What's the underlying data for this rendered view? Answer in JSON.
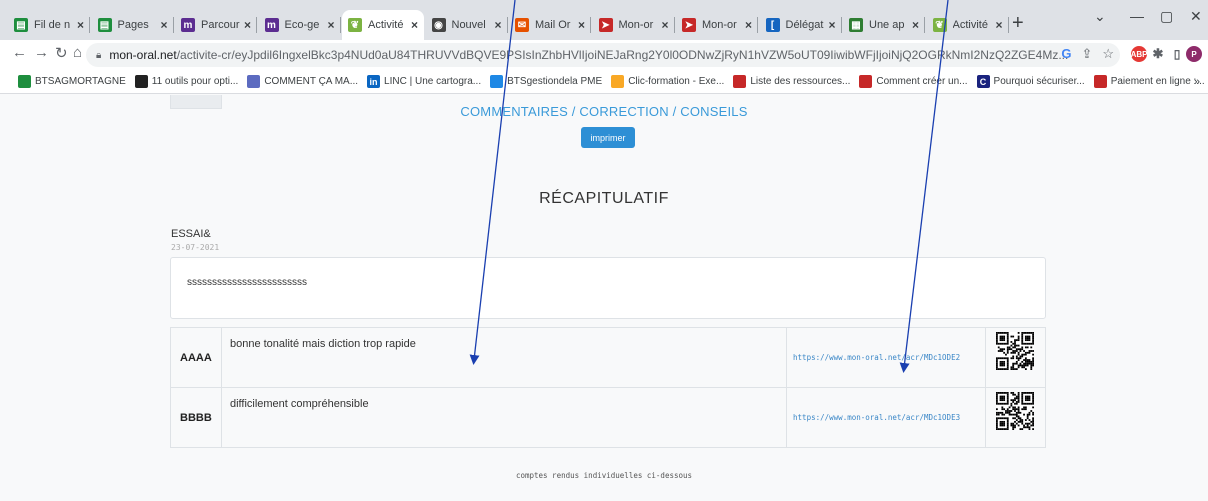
{
  "browser": {
    "tabs": [
      {
        "label": "Fil de n",
        "icon": "classroom-icon",
        "color": "#1e8e3e",
        "glyph": "▤"
      },
      {
        "label": "Pages",
        "icon": "classroom-icon",
        "color": "#1e8e3e",
        "glyph": "▤"
      },
      {
        "label": "Parcour",
        "icon": "m-logo-icon",
        "color": "#5c2d91",
        "glyph": "m"
      },
      {
        "label": "Eco-ge",
        "icon": "m-logo-icon",
        "color": "#5c2d91",
        "glyph": "m"
      },
      {
        "label": "Activité",
        "icon": "leaf-icon",
        "color": "#7cb342",
        "glyph": "❦",
        "active": true
      },
      {
        "label": "Nouvel",
        "icon": "chrome-icon",
        "color": "#444",
        "glyph": "◉"
      },
      {
        "label": "Mail Or",
        "icon": "mail-icon",
        "color": "#e65100",
        "glyph": "✉"
      },
      {
        "label": "Mon-or",
        "icon": "bird-icon",
        "color": "#c62828",
        "glyph": "➤"
      },
      {
        "label": "Mon-or",
        "icon": "bird-icon",
        "color": "#c62828",
        "glyph": "➤"
      },
      {
        "label": "Délégat",
        "icon": "flag-icon",
        "color": "#1565c0",
        "glyph": "["
      },
      {
        "label": "Une ap",
        "icon": "image-icon",
        "color": "#2e7d32",
        "glyph": "▦"
      },
      {
        "label": "Activité",
        "icon": "leaf-icon",
        "color": "#7cb342",
        "glyph": "❦"
      }
    ],
    "new_tab": "+",
    "url_domain": "mon-oral.net",
    "url_path": "/activite-cr/eyJpdil6IngxelBkc3p4NUd0aU84THRUVVdBQVE9PSIsInZhbHVlIjoiNEJaRng2Y0l0ODNwZjRyN1hVZW5oUT09IiwibWFjIjoiNjQ2OGRkNmI2NzQ2ZGE4Mz..."
  },
  "bookmarks": [
    {
      "label": "BTSAGMORTAGNE",
      "icon": "classroom-icon",
      "color": "#1e8e3e"
    },
    {
      "label": "11 outils pour opti...",
      "icon": "bookmark-icon",
      "color": "#222"
    },
    {
      "label": "COMMENT ÇA MA...",
      "icon": "ccm-icon",
      "color": "#5c6bc0"
    },
    {
      "label": "LINC | Une cartogra...",
      "icon": "linkedin-icon",
      "color": "#0a66c2"
    },
    {
      "label": "BTSgestiondela PME",
      "icon": "classroom-icon",
      "color": "#1e88e5"
    },
    {
      "label": "Clic-formation - Exe...",
      "icon": "circle-icon",
      "color": "#f9a825"
    },
    {
      "label": "Liste des ressources...",
      "icon": "flag-icon",
      "color": "#c62828"
    },
    {
      "label": "Comment créer un...",
      "icon": "flag-icon",
      "color": "#c62828"
    },
    {
      "label": "Pourquoi sécuriser...",
      "icon": "c-logo-icon",
      "color": "#1a237e"
    },
    {
      "label": "Paiement en ligne :...",
      "icon": "flag-icon",
      "color": "#c62828"
    }
  ],
  "page": {
    "section_title": "COMMENTAIRES / CORRECTION / CONSEILS",
    "print_label": "imprimer",
    "recap_title": "RÉCAPITULATIF",
    "activity_name": "ESSAI&",
    "date": "23-07-2021",
    "text_content": "ssssssssssssssssssssssss",
    "results": [
      {
        "code": "AAAA",
        "comment": "bonne tonalité mais diction trop rapide",
        "url": "https://www.mon-oral.net/acr/MDc1ODE2"
      },
      {
        "code": "BBBB",
        "comment": "difficilement compréhensible",
        "url": "https://www.mon-oral.net/acr/MDc1ODE3"
      }
    ],
    "footer_note": "comptes rendus individuelles ci-dessous"
  },
  "colors": {
    "accent": "#3a9ad9",
    "button": "#2d8fd5",
    "arrow": "#1a3fb0"
  }
}
